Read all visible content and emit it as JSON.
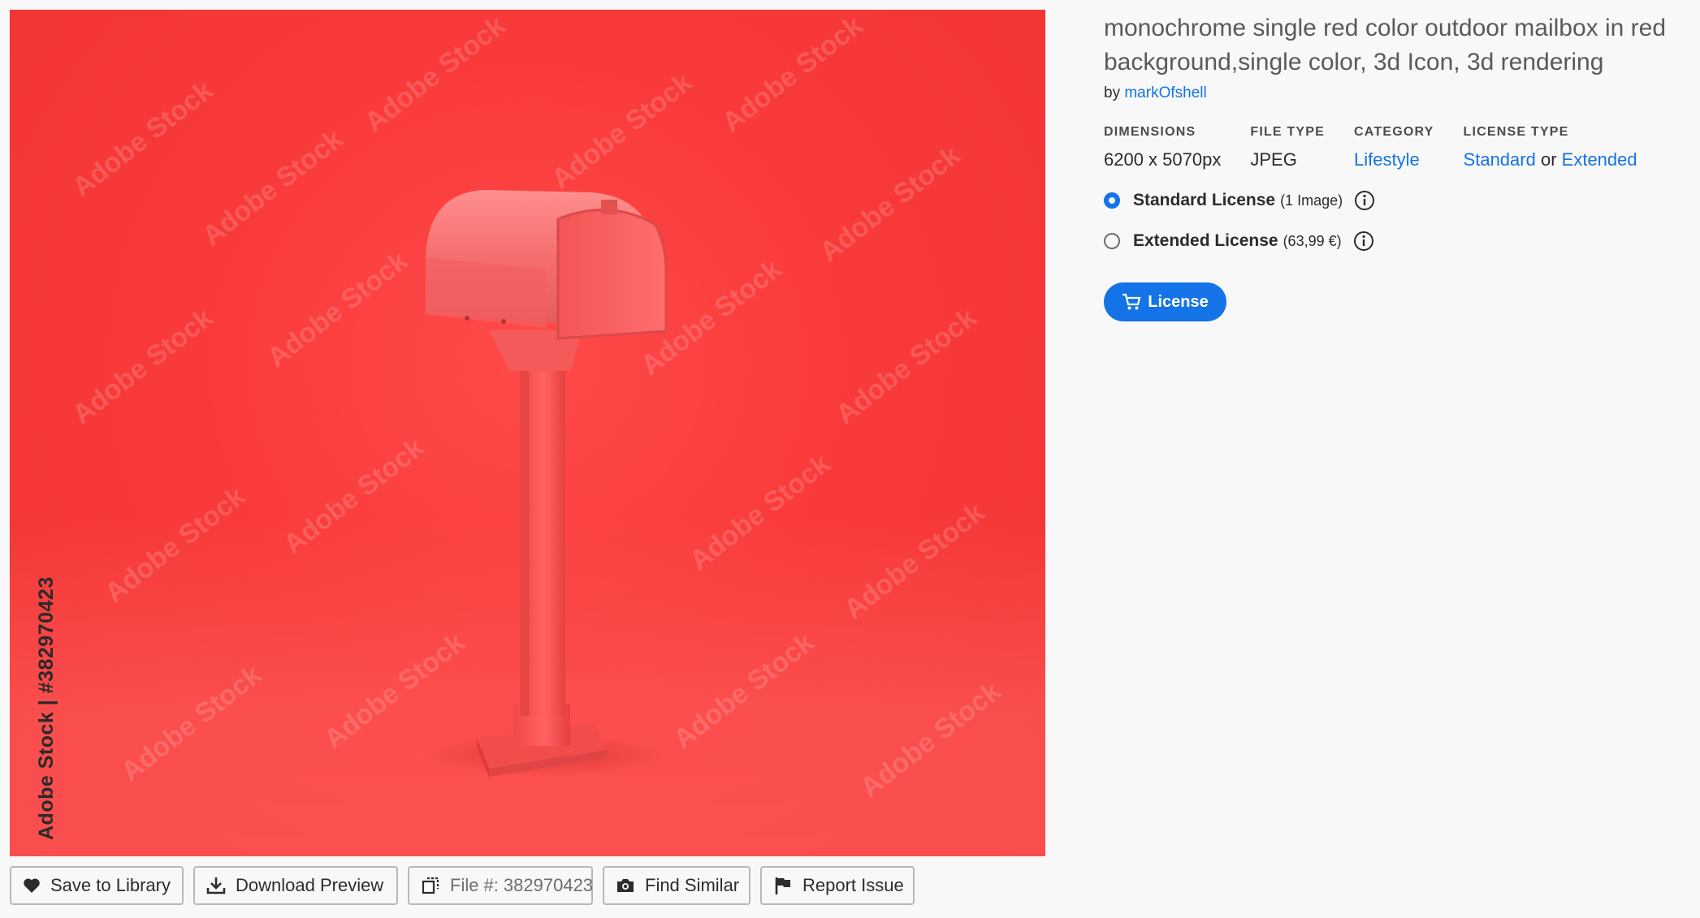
{
  "asset": {
    "title": "monochrome single red color outdoor mailbox in red background,single color, 3d Icon, 3d rendering",
    "by_prefix": "by",
    "author": "markOfshell",
    "watermark_text": "Adobe Stock",
    "vertical_credit": "Adobe Stock | #382970423"
  },
  "meta": {
    "dimensions_label": "DIMENSIONS",
    "dimensions_value": "6200 x 5070px",
    "filetype_label": "FILE TYPE",
    "filetype_value": "JPEG",
    "category_label": "CATEGORY",
    "category_value": "Lifestyle",
    "licensetype_label": "LICENSE TYPE",
    "licensetype_standard": "Standard",
    "licensetype_or": "or",
    "licensetype_extended": "Extended"
  },
  "licenses": {
    "standard_name": "Standard License",
    "standard_detail": "(1 Image)",
    "extended_name": "Extended License",
    "extended_detail": "(63,99 €)",
    "selected": "standard"
  },
  "license_button": "License",
  "actions": {
    "save": "Save to Library",
    "download": "Download Preview",
    "file_prefix": "File #:",
    "file_number": "382970423",
    "similar": "Find Similar",
    "report": "Report Issue"
  },
  "colors": {
    "accent": "#1473e6",
    "image_bg": "#f93a3a"
  },
  "icons": [
    "heart-icon",
    "download-icon",
    "copy-icon",
    "camera-icon",
    "flag-icon",
    "cart-icon",
    "info-icon"
  ]
}
